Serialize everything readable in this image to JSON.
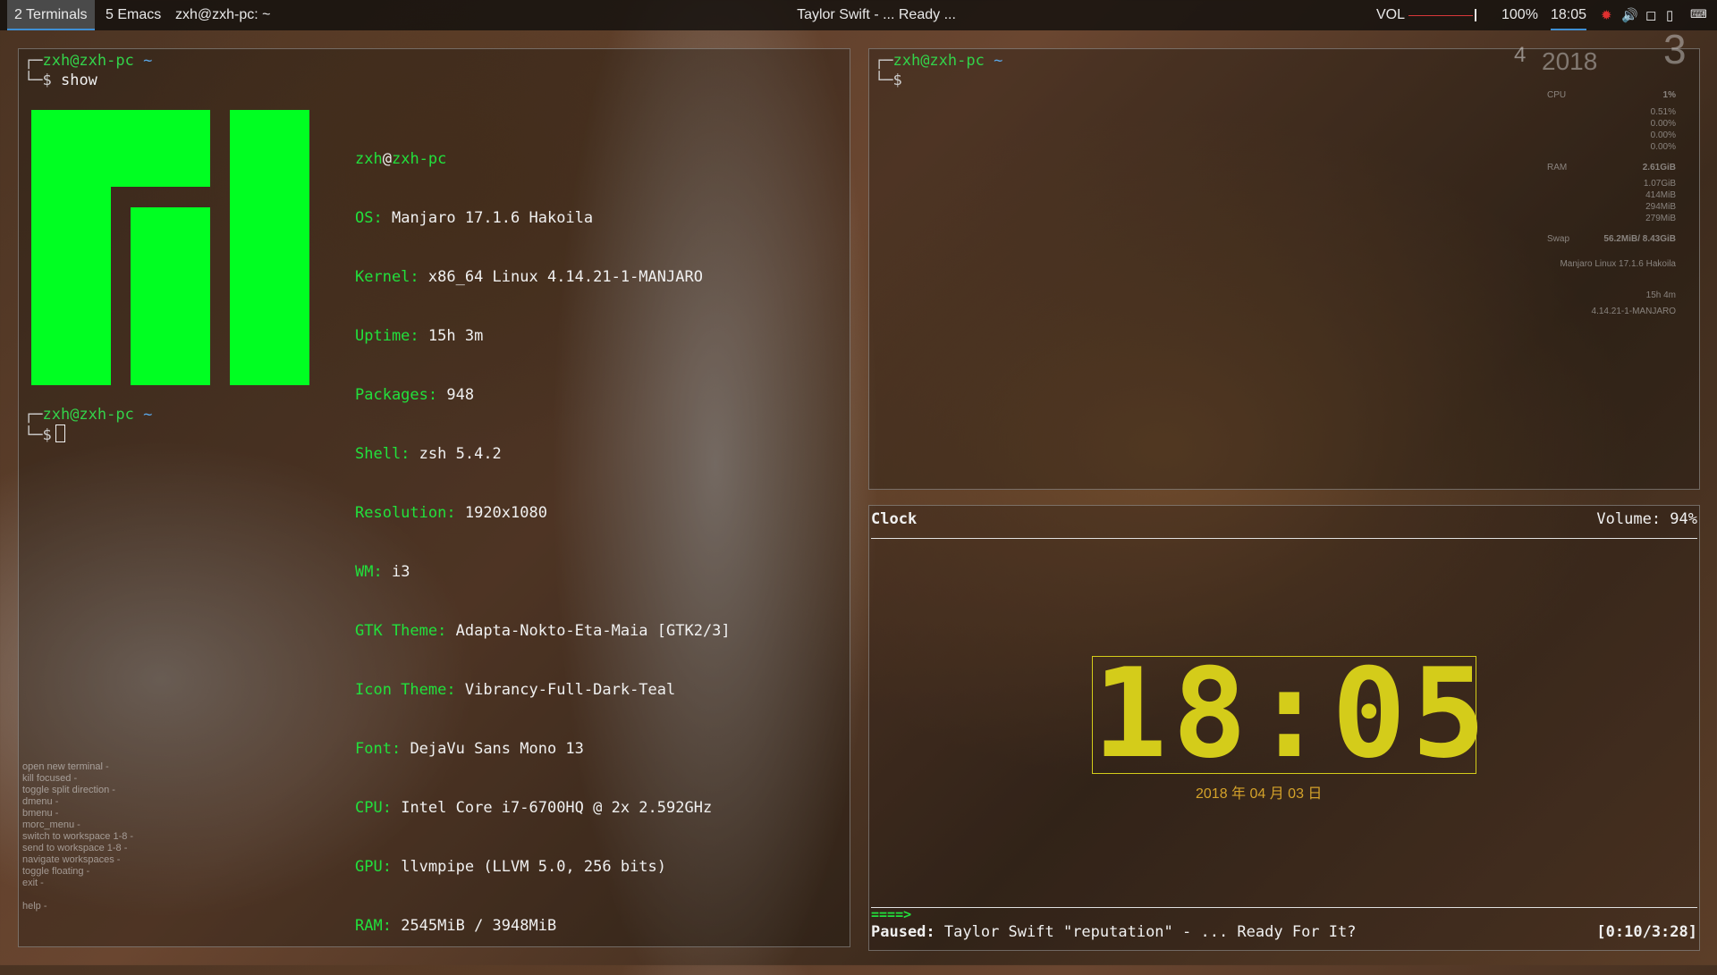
{
  "topbar": {
    "workspaces": [
      {
        "label": "2 Terminals",
        "active": true
      },
      {
        "label": "5 Emacs",
        "active": false
      },
      {
        "label": "zxh@zxh-pc: ~",
        "active": false
      }
    ],
    "title": "Taylor Swift - ... Ready ...",
    "vol_label": "VOL",
    "vol_level": 0.94,
    "brightness": "100%",
    "time": "18:05",
    "tray_icons": [
      "red-indicator-icon",
      "speaker-icon",
      "square-icon",
      "clipboard-icon",
      "keyboard-icon"
    ]
  },
  "left_terminal": {
    "prompt1": {
      "corner_top": "┌─",
      "user_host": "zxh@zxh-pc",
      "path": "~",
      "corner_bottom": "└─$",
      "command": "show"
    },
    "logo_color": "#00ff22",
    "sysinfo": {
      "user": "zxh",
      "at": "@",
      "host": "zxh-pc",
      "rows": [
        {
          "key": "OS:",
          "value": "Manjaro 17.1.6 Hakoila"
        },
        {
          "key": "Kernel:",
          "value": "x86_64 Linux 4.14.21-1-MANJARO"
        },
        {
          "key": "Uptime:",
          "value": "15h 3m"
        },
        {
          "key": "Packages:",
          "value": "948"
        },
        {
          "key": "Shell:",
          "value": "zsh 5.4.2"
        },
        {
          "key": "Resolution:",
          "value": "1920x1080"
        },
        {
          "key": "WM:",
          "value": "i3"
        },
        {
          "key": "GTK Theme:",
          "value": "Adapta-Nokto-Eta-Maia [GTK2/3]"
        },
        {
          "key": "Icon Theme:",
          "value": "Vibrancy-Full-Dark-Teal"
        },
        {
          "key": "Font:",
          "value": "DejaVu Sans Mono 13"
        },
        {
          "key": "CPU:",
          "value": "Intel Core i7-6700HQ @ 2x 2.592GHz"
        },
        {
          "key": "GPU:",
          "value": "llvmpipe (LLVM 5.0, 256 bits)"
        },
        {
          "key": "RAM:",
          "value": "2545MiB / 3948MiB"
        }
      ]
    },
    "prompt2": {
      "corner_top": "┌─",
      "user_host": "zxh@zxh-pc",
      "path": "~",
      "corner_bottom": "└─$"
    },
    "hints": [
      "open new terminal -",
      "kill focused -",
      "toggle split direction -",
      "dmenu -",
      "bmenu -",
      "morc_menu -",
      "switch to workspace 1-8 -",
      "send to workspace 1-8 -",
      "navigate workspaces -",
      "toggle floating -",
      "exit -",
      "",
      "help -"
    ]
  },
  "top_right_terminal": {
    "corner_top": "┌─",
    "user_host": "zxh@zxh-pc",
    "path": "~",
    "corner_bottom": "└─$"
  },
  "conky": {
    "day": "3",
    "month": "4",
    "year": "2018",
    "cpu_label": "CPU",
    "cpu_value": "1%",
    "cpu_rows": [
      "0.51%",
      "0.00%",
      "0.00%",
      "0.00%"
    ],
    "ram_label": "RAM",
    "ram_value": "2.61GiB",
    "ram_rows": [
      "1.07GiB",
      "414MiB",
      "294MiB",
      "279MiB"
    ],
    "swap_label": "Swap",
    "swap_value": "56.2MiB/ 8.43GiB",
    "os": "Manjaro Linux 17.1.6 Hakoila",
    "uptime": "15h 4m",
    "kernel": "4.14.21-1-MANJARO"
  },
  "clock_pane": {
    "title": "Clock",
    "volume": "Volume: 94%",
    "time_display": "18:05",
    "date": "2018 年 04 月 03 日",
    "arrow": "====>",
    "status_label": "Paused:",
    "song": "Taylor Swift \"reputation\" - ... Ready For It?",
    "progress": "[0:10/3:28]"
  }
}
